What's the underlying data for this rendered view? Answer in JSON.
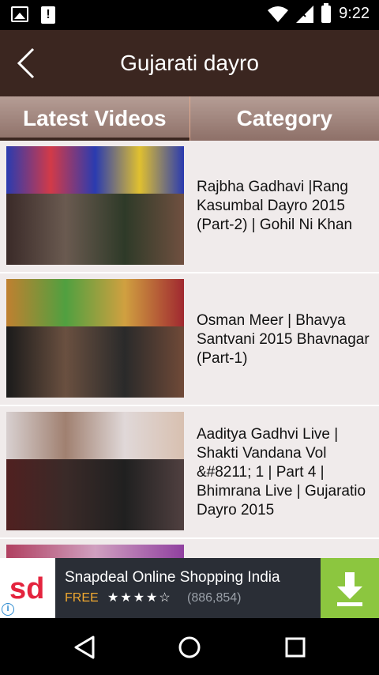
{
  "status_bar": {
    "time": "9:22",
    "icons": [
      "image-icon",
      "alert-icon",
      "wifi-icon",
      "signal-icon",
      "battery-icon"
    ]
  },
  "app_bar": {
    "title": "Gujarati dayro",
    "back_icon": "chevron-left-icon"
  },
  "tabs": [
    {
      "label": "Latest Videos",
      "active": true
    },
    {
      "label": "Category",
      "active": false
    }
  ],
  "videos": [
    {
      "title": "Rajbha Gadhavi |Rang Kasumbal Dayro 2015 (Part-2) | Gohil Ni Khan"
    },
    {
      "title": "Osman Meer | Bhavya Santvani 2015 Bhavnagar (Part-1)"
    },
    {
      "title": "Aaditya Gadhvi Live | Shakti Vandana Vol &#8211; 1 | Part 4 | Bhimrana Live | Gujaratio Dayro 2015"
    }
  ],
  "ad": {
    "logo_text": "sd",
    "title": "Snapdeal Online Shopping India",
    "price": "FREE",
    "rating_stars": "★★★★☆",
    "rating_count": "(886,854)",
    "info_icon": "info-icon",
    "download_icon": "download-icon",
    "colors": {
      "brand": "#e4243e",
      "download_bg": "#8cc63f"
    }
  },
  "nav_bar": {
    "icons": [
      "back-triangle-icon",
      "home-circle-icon",
      "recents-square-icon"
    ]
  },
  "colors": {
    "app_bar": "#3b2620",
    "tab_bg": "#9e827a",
    "list_bg": "#f0ebeb"
  }
}
